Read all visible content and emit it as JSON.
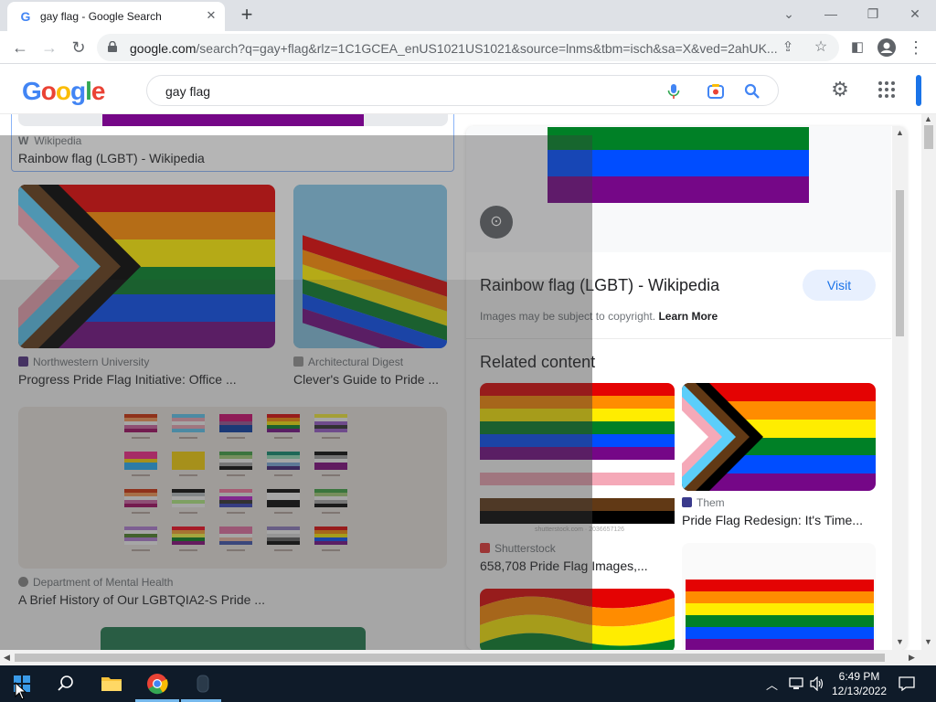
{
  "browser": {
    "tab_title": "gay flag - Google Search",
    "tab_favicon": "G",
    "url_host": "google.com",
    "url_rest": "/search?q=gay+flag&rlz=1C1GCEA_enUS1021US1021&source=lnms&tbm=isch&sa=X&ved=2ahUK...",
    "new_tab": "+"
  },
  "google": {
    "logo": [
      "G",
      "o",
      "o",
      "g",
      "l",
      "e"
    ],
    "logo_colors": [
      "#4285f4",
      "#ea4335",
      "#fbbc05",
      "#4285f4",
      "#34a853",
      "#ea4335"
    ],
    "query": "gay flag"
  },
  "results": {
    "top_card": {
      "source": "Wikipedia",
      "caption": "Rainbow flag (LGBT) - Wikipedia"
    },
    "row1": [
      {
        "source": "Northwestern University",
        "caption": "Progress Pride Flag Initiative: Office ..."
      },
      {
        "source": "Architectural Digest",
        "caption": "Clever's Guide to Pride ..."
      }
    ],
    "row2": [
      {
        "source": "Department of Mental Health",
        "caption": "A Brief History of Our LGBTQIA2-S Pride ..."
      }
    ]
  },
  "panel": {
    "title": "Rainbow flag (LGBT) - Wikipedia",
    "visit": "Visit",
    "copyright": "Images may be subject to copyright.",
    "learn_more": "Learn More",
    "related_heading": "Related content",
    "related": [
      {
        "source": "Shutterstock",
        "caption": "658,708 Pride Flag Images,...",
        "watermark": "shutterstock.com · 2036657126"
      },
      {
        "source": "Them",
        "caption": "Pride Flag Redesign: It's Time..."
      }
    ]
  },
  "taskbar": {
    "time": "6:49 PM",
    "date": "12/13/2022"
  },
  "colors": {
    "accent": "#1a73e8",
    "rainbow": [
      "#e40303",
      "#ff8c00",
      "#ffed00",
      "#008026",
      "#004dff",
      "#750787"
    ],
    "trans_blue": "#5bcefa",
    "trans_pink": "#f5a9b8",
    "brown": "#613915"
  }
}
